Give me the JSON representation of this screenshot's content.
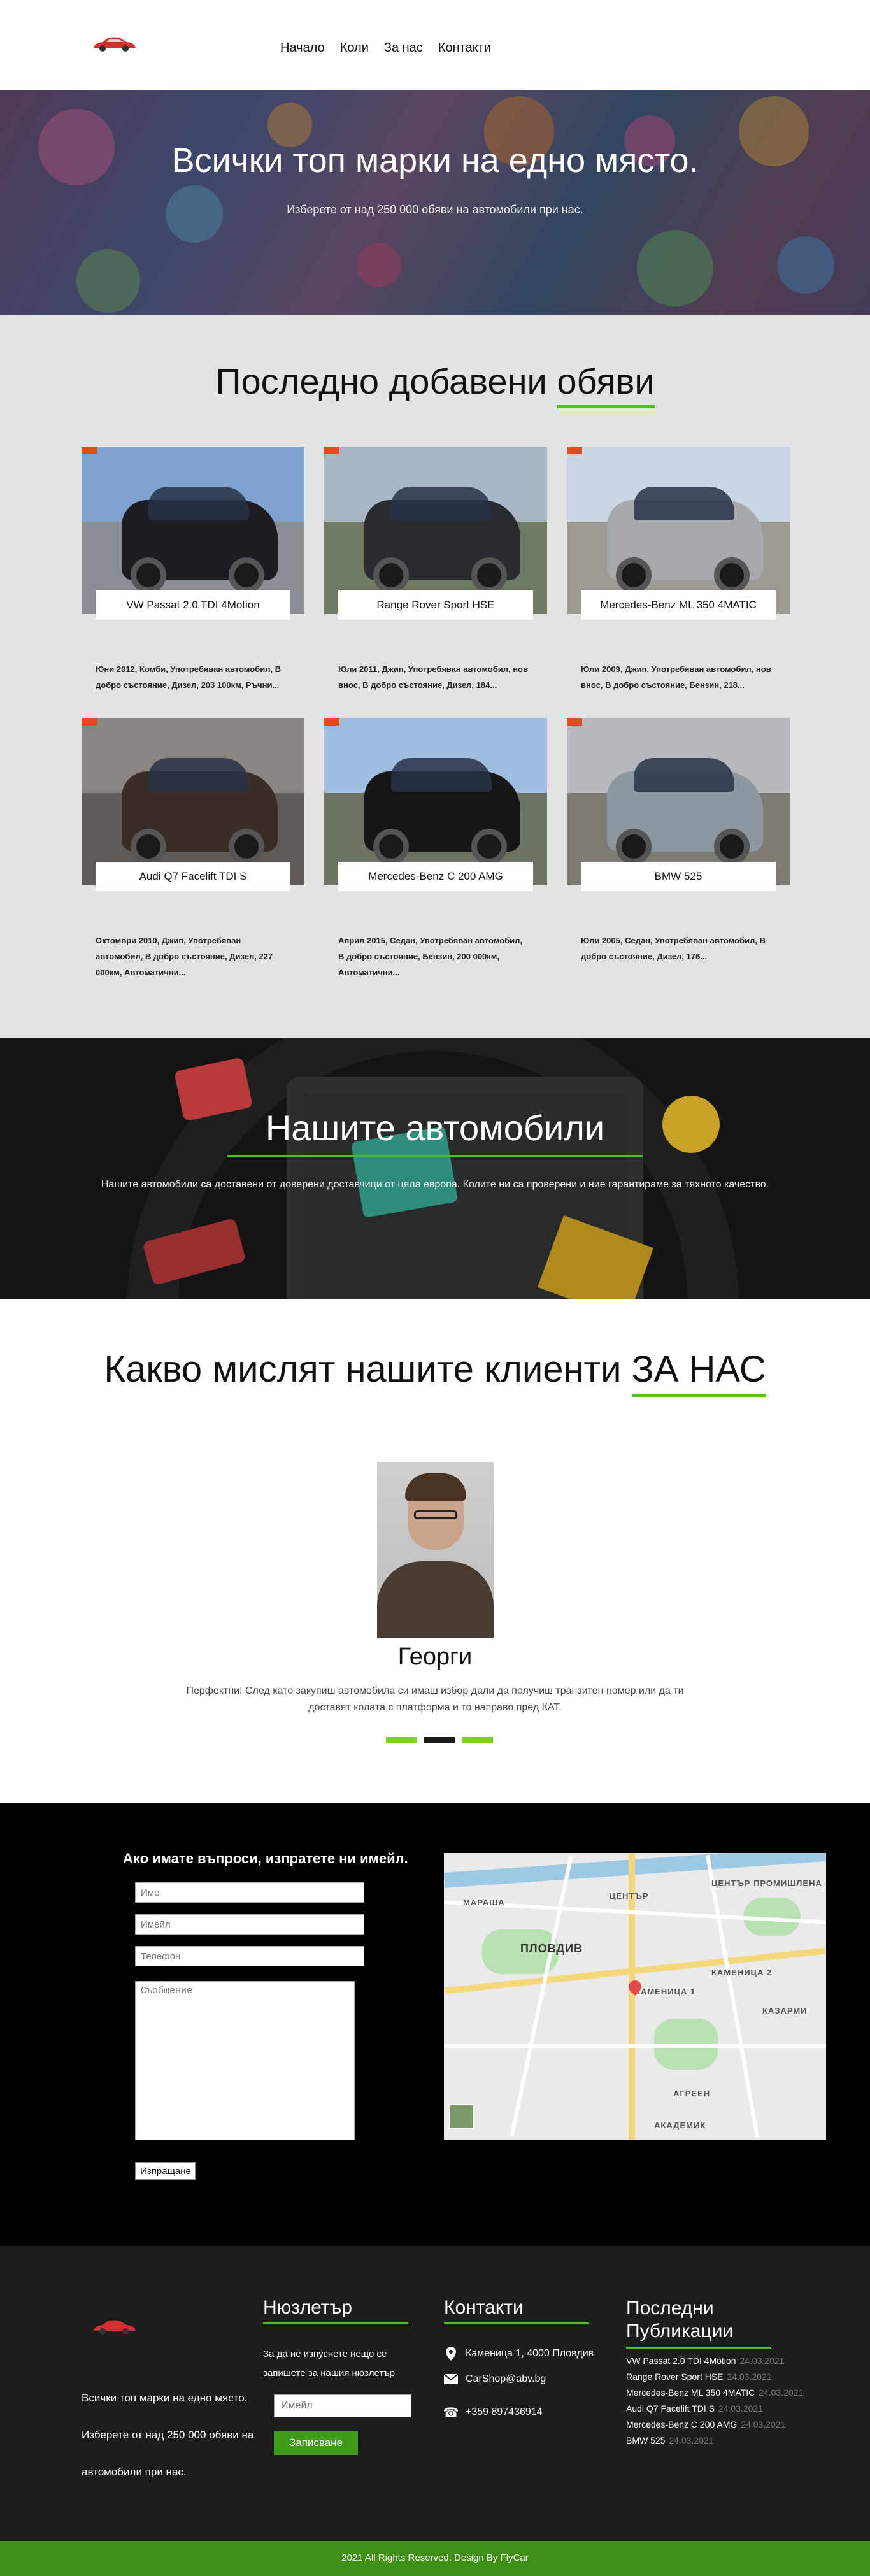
{
  "nav": {
    "items": [
      "Начало",
      "Коли",
      "За нас",
      "Контакти"
    ]
  },
  "hero": {
    "title": "Всички топ марки на едно място.",
    "subtitle": "Изберете от над 250 000 обяви на автомобили при нас."
  },
  "latest": {
    "title_main": "Последно добавени ",
    "title_accent": "обяви",
    "cards": [
      {
        "name": "VW Passat 2.0 TDI 4Motion",
        "desc": "Юни 2012, Комби, Употребяван автомобил, В добро състояние, Дизел, 203 100км, Ръчни...",
        "color": "#1c1c22",
        "sky": "#7fa3cf",
        "ground": "#8a8f95"
      },
      {
        "name": "Range Rover Sport HSE",
        "desc": "Юли 2011, Джип, Употребяван автомобил, нов внос, В добро състояние, Дизел, 184...",
        "color": "#2a2b2e",
        "sky": "#a8b7c6",
        "ground": "#6f7a64"
      },
      {
        "name": "Mercedes-Benz ML 350 4MATIC",
        "desc": "Юли 2009, Джип, Употребяван автомобил, нов внос, В добро състояние, Бензин, 218...",
        "color": "#a7a9ad",
        "sky": "#c9d6e6",
        "ground": "#9c9a92"
      },
      {
        "name": "Audi Q7 Facelift TDI S",
        "desc": "Октомври 2010, Джип, Употребяван автомобил, В добро състояние, Дизел, 227 000км, Автоматични...",
        "color": "#3a2d27",
        "sky": "#8a8580",
        "ground": "#5f5a55"
      },
      {
        "name": "Mercedes-Benz C 200 AMG",
        "desc": "Април 2015, Седан, Употребяван автомобил, В добро състояние, Бензин, 200 000км, Автоматични...",
        "color": "#161618",
        "sky": "#9fbde0",
        "ground": "#6d7464"
      },
      {
        "name": "BMW 525",
        "desc": "Юли 2005, Седан, Употребяван автомобил, В добро състояние, Дизел, 176...",
        "color": "#8c97a0",
        "sky": "#b5b9bd",
        "ground": "#7d7b74"
      }
    ]
  },
  "ourcars": {
    "title": "Нашите автомобили",
    "text": "Нашите автомобили са доставени от доверени доставчици от цяла европа. Колите ни са проверени и ние гарантираме за тяхното качество."
  },
  "testimonials": {
    "title_main": "Какво мислят нашите клиенти ",
    "title_accent": "ЗА НАС",
    "name": "Георги",
    "quote": "Перфектни! След като закупиш автомобила си имаш избор дали да получиш транзитен номер или да ти доставят колата с платформа и то направо пред КАТ.",
    "active_dot": 1
  },
  "contact": {
    "heading": "Ако имате въпроси, изпратете ни имейл.",
    "placeholders": {
      "name": "Име",
      "email": "Имейл",
      "phone": "Телефон",
      "message": "Съобщение"
    },
    "submit": "Изпращане",
    "map_labels": [
      "МАРАША",
      "ЦЕНТЪР",
      "ПЛОВДИВ",
      "КАМЕНИЦА 1",
      "КАМЕНИЦА 2",
      "ЦЕНТЪР ПРОМИШЛЕНА",
      "КАЗАРМИ",
      "АКАДЕМИК",
      "АГРЕЕН"
    ]
  },
  "footer": {
    "about": "Всички топ марки на едно място. Изберете от над 250 000 обяви на автомобили при нас.",
    "newsletter_title": "Нюзлетър",
    "newsletter_text": "За да не изпуснете нещо се запишете за нашия нюзлетър",
    "newsletter_placeholder": "Имейл",
    "newsletter_button": "Записване",
    "contacts_title": "Контакти",
    "address": "Каменица 1, 4000 Пловдив",
    "email": "CarShop@abv.bg",
    "phone": "+359 897436914",
    "pubs_title": "Последни Публикации",
    "pubs": [
      {
        "name": "VW Passat 2.0 TDI 4Motion",
        "date": "24.03.2021"
      },
      {
        "name": "Range Rover Sport HSE",
        "date": "24.03.2021"
      },
      {
        "name": "Mercedes-Benz ML 350 4MATIC",
        "date": "24.03.2021"
      },
      {
        "name": "Audi Q7 Facelift TDI S",
        "date": "24.03.2021"
      },
      {
        "name": "Mercedes-Benz C 200 AMG",
        "date": "24.03.2021"
      },
      {
        "name": "BMW 525",
        "date": "24.03.2021"
      }
    ],
    "copyright": "2021 All Rights Reserved. Design By FlyCar"
  },
  "colors": {
    "accent": "#4cc31c",
    "button_green": "#3f9b1a",
    "logo_red": "#d32f2f"
  }
}
